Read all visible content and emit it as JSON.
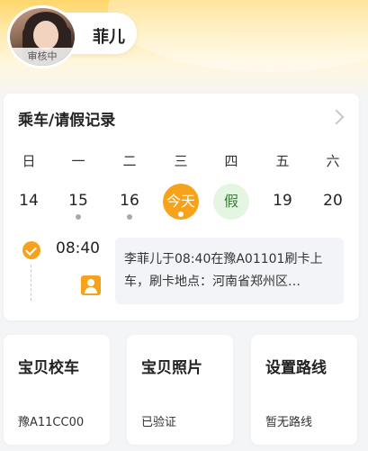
{
  "profile": {
    "name": "菲儿",
    "status_badge": "审核中",
    "avatar_icon": "child-photo"
  },
  "record": {
    "title": "乘车/请假记录",
    "weekdays": [
      "日",
      "一",
      "二",
      "三",
      "四",
      "五",
      "六"
    ],
    "dates": [
      {
        "label": "14",
        "dot": false,
        "state": "normal"
      },
      {
        "label": "15",
        "dot": true,
        "state": "normal"
      },
      {
        "label": "16",
        "dot": true,
        "state": "normal"
      },
      {
        "label": "今天",
        "dot": true,
        "state": "today"
      },
      {
        "label": "假",
        "dot": false,
        "state": "leave"
      },
      {
        "label": "19",
        "dot": false,
        "state": "normal"
      },
      {
        "label": "20",
        "dot": false,
        "state": "normal"
      }
    ],
    "entry": {
      "time": "08:40",
      "line1": "李菲儿于08:40在豫A01101刷卡上",
      "line2": "车，刷卡地点：河南省郑州区…"
    }
  },
  "actions": [
    {
      "title": "宝贝校车",
      "sub": "豫A11CC00"
    },
    {
      "title": "宝贝照片",
      "sub": "已验证"
    },
    {
      "title": "设置路线",
      "sub": "暂无路线"
    }
  ],
  "colors": {
    "accent": "#f7a21b",
    "header": "#ffd66b",
    "leave_bg": "#e4f6e1"
  }
}
